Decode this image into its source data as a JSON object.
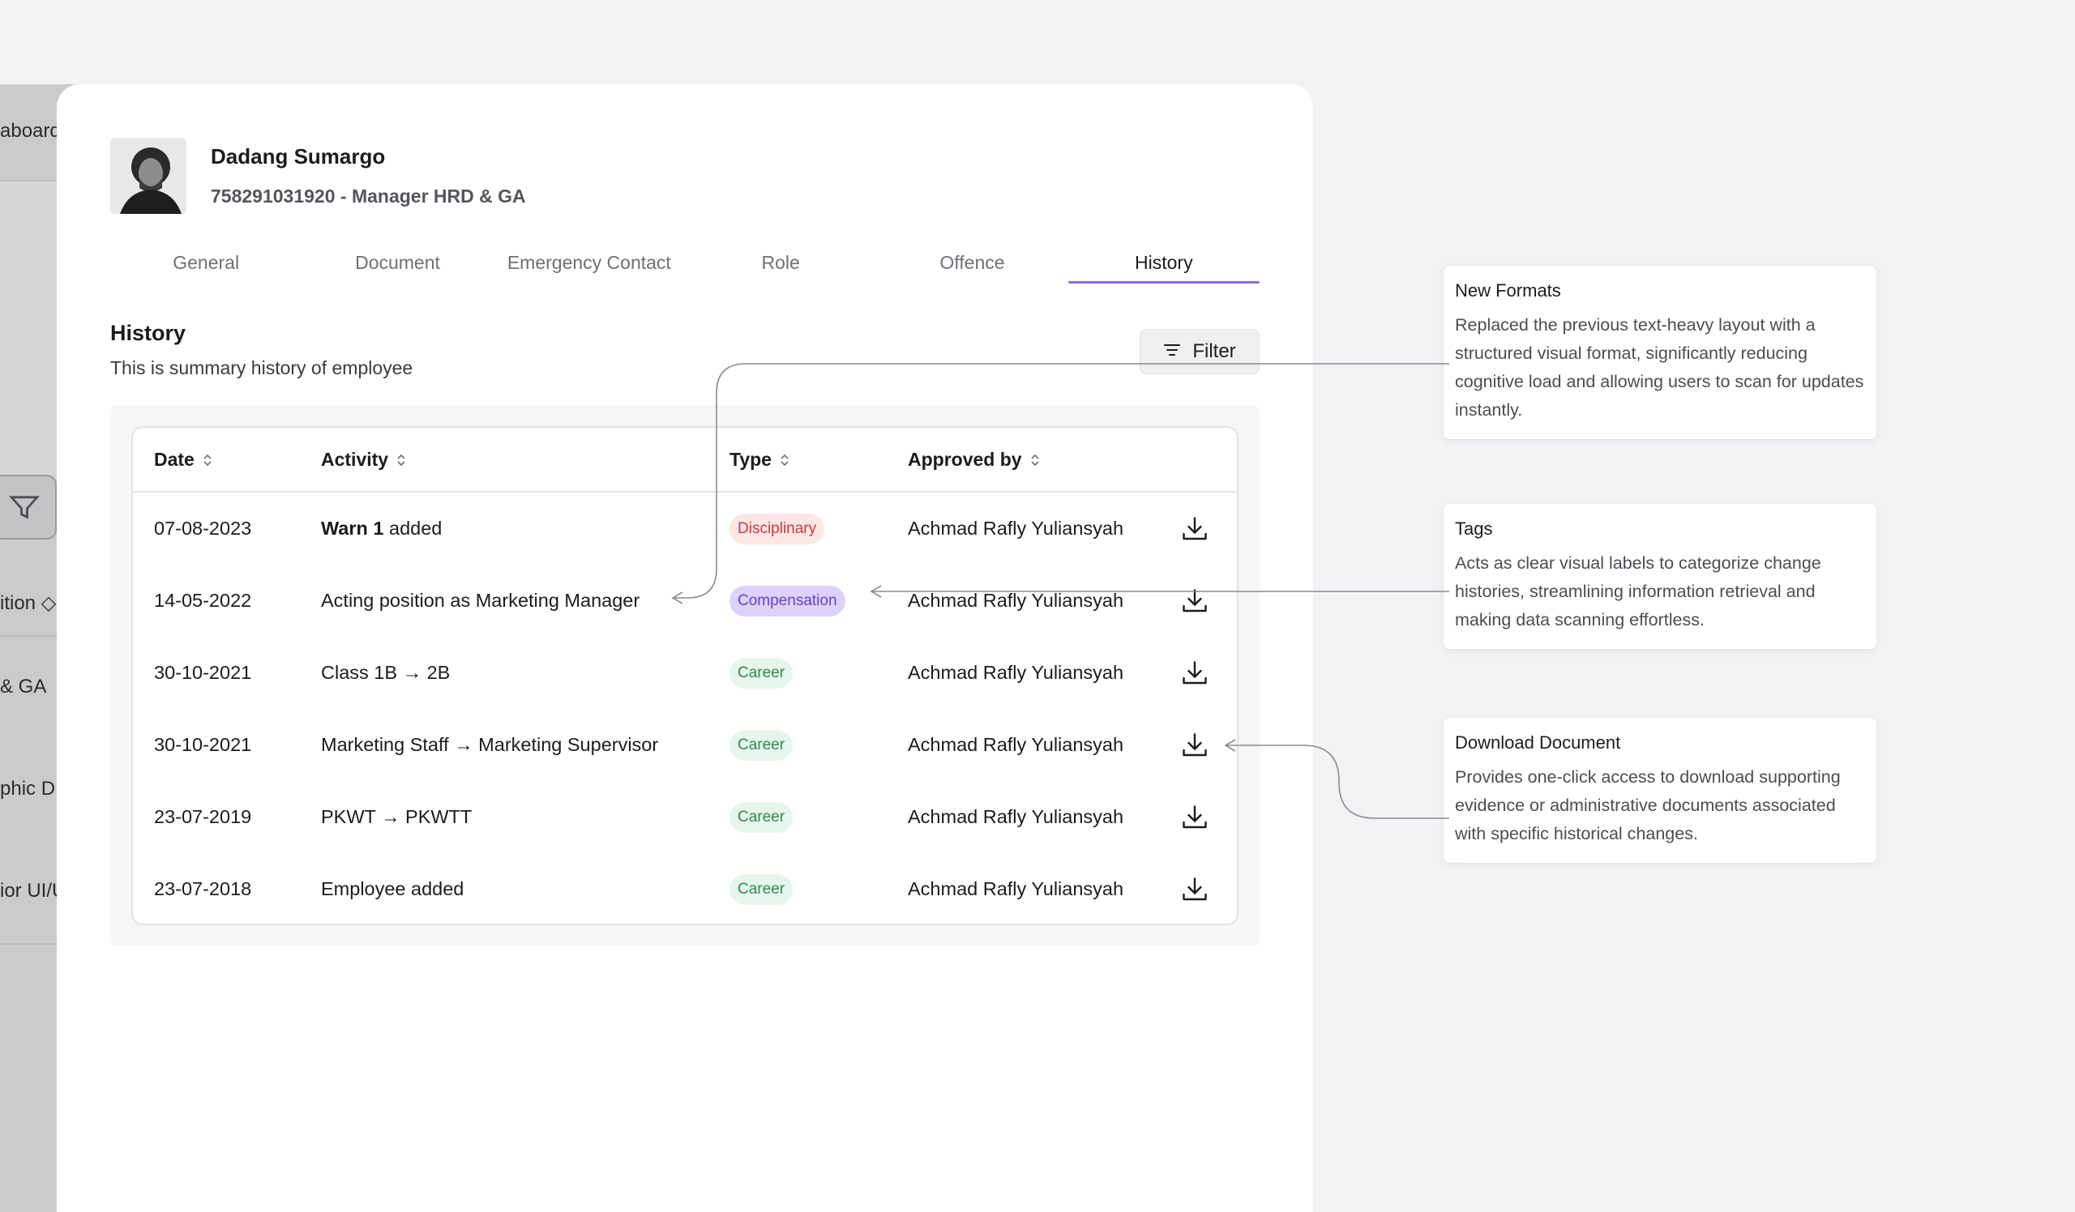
{
  "sidebar_bg": {
    "items": [
      "aboard",
      "ition",
      "& GA",
      "phic D",
      "ior UI/U"
    ]
  },
  "profile": {
    "name": "Dadang Sumargo",
    "subtitle": "758291031920 - Manager HRD & GA"
  },
  "tabs": [
    {
      "label": "General"
    },
    {
      "label": "Document"
    },
    {
      "label": "Emergency Contact"
    },
    {
      "label": "Role"
    },
    {
      "label": "Offence"
    },
    {
      "label": "History",
      "active": true
    }
  ],
  "section": {
    "title": "History",
    "subtitle": "This is summary history of employee",
    "filter_label": "Filter"
  },
  "table": {
    "headers": [
      "Date",
      "Activity",
      "Type",
      "Approved by"
    ],
    "rows": [
      {
        "date": "07-08-2023",
        "activity_bold": "Warn 1",
        "activity": " added",
        "type": "Disciplinary",
        "approved_by": "Achmad Rafly Yuliansyah"
      },
      {
        "date": "14-05-2022",
        "activity_bold": "",
        "activity": "Acting position as Marketing Manager",
        "type": "Compensation",
        "approved_by": "Achmad Rafly Yuliansyah"
      },
      {
        "date": "30-10-2021",
        "activity_bold": "",
        "activity": "Class 1B → 2B",
        "type": "Career",
        "approved_by": "Achmad Rafly Yuliansyah"
      },
      {
        "date": "30-10-2021",
        "activity_bold": "",
        "activity": "Marketing Staff → Marketing Supervisor",
        "type": "Career",
        "approved_by": "Achmad Rafly Yuliansyah"
      },
      {
        "date": "23-07-2019",
        "activity_bold": "",
        "activity": "PKWT → PKWTT",
        "type": "Career",
        "approved_by": "Achmad Rafly Yuliansyah"
      },
      {
        "date": "23-07-2018",
        "activity_bold": "",
        "activity": "Employee added",
        "type": "Career",
        "approved_by": "Achmad Rafly Yuliansyah"
      }
    ]
  },
  "callouts": [
    {
      "title": "New Formats",
      "body": "Replaced the previous text-heavy layout with a structured visual format, significantly reducing cognitive load and allowing users to scan for updates instantly."
    },
    {
      "title": "Tags",
      "body": "Acts as clear visual labels to categorize change histories, streamlining information retrieval and making data scanning effortless."
    },
    {
      "title": "Download Document",
      "body": "Provides one-click access to download supporting evidence or administrative documents associated with specific historical changes."
    }
  ],
  "colors": {
    "accent": "#8b6cde",
    "disciplinary": "#cf3a3a",
    "compensation": "#6a3fd3",
    "career": "#2d8a4f"
  }
}
